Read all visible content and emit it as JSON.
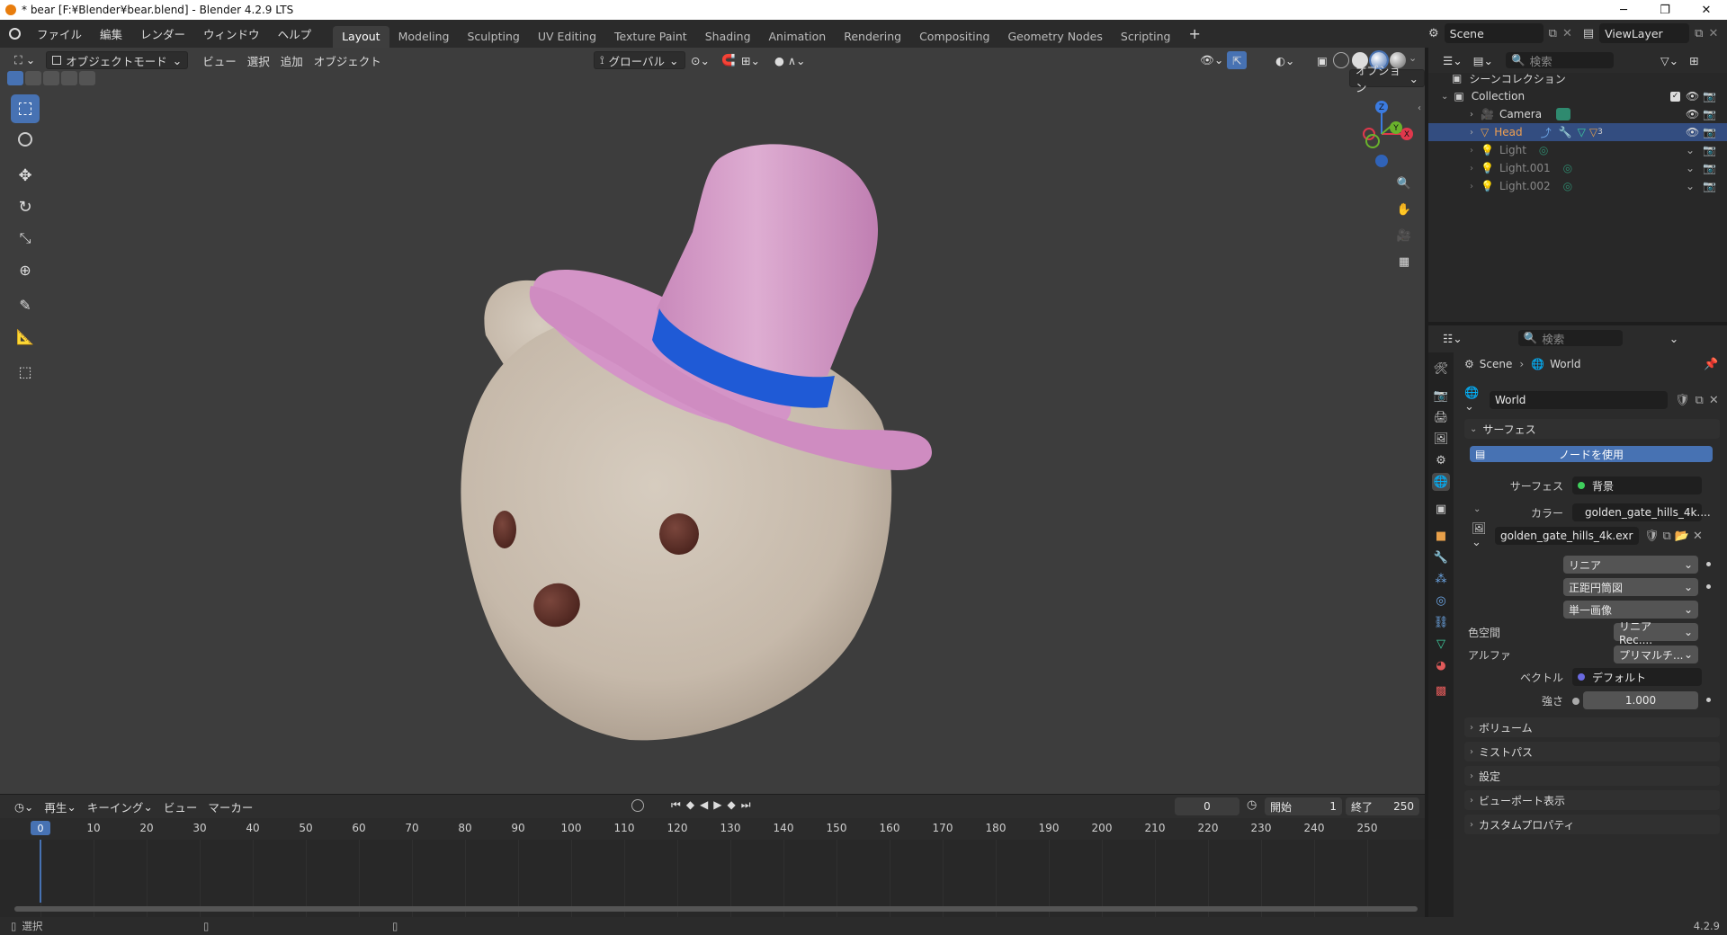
{
  "app": {
    "window_title": "* bear [F:¥Blender¥bear.blend] - Blender 4.2.9 LTS",
    "version": "4.2.9"
  },
  "menu": [
    "ファイル",
    "編集",
    "レンダー",
    "ウィンドウ",
    "ヘルプ"
  ],
  "workspaces": [
    "Layout",
    "Modeling",
    "Sculpting",
    "UV Editing",
    "Texture Paint",
    "Shading",
    "Animation",
    "Rendering",
    "Compositing",
    "Geometry Nodes",
    "Scripting"
  ],
  "active_workspace": "Layout",
  "scene_selector": {
    "scene": "Scene",
    "view_layer": "ViewLayer"
  },
  "viewport": {
    "mode": "オブジェクトモード",
    "menus": [
      "ビュー",
      "選択",
      "追加",
      "オブジェクト"
    ],
    "transform_orientation": "グローバル",
    "options_label": "オプション",
    "gizmo_axes": {
      "x": "X",
      "y": "Y",
      "z": "Z"
    }
  },
  "outliner": {
    "search_placeholder": "検索",
    "root": "シーンコレクション",
    "collection": "Collection",
    "items": [
      {
        "name": "Camera",
        "selected": false
      },
      {
        "name": "Head",
        "selected": true,
        "extra": "3"
      },
      {
        "name": "Light",
        "selected": false
      },
      {
        "name": "Light.001",
        "selected": false
      },
      {
        "name": "Light.002",
        "selected": false
      }
    ]
  },
  "properties": {
    "search_placeholder": "検索",
    "breadcrumb": [
      "Scene",
      "World"
    ],
    "world_name": "World",
    "surface_panel": "サーフェス",
    "use_nodes_button": "ノードを使用",
    "surface_label": "サーフェス",
    "surface_value": "背景",
    "color_label": "カラー",
    "color_value": "golden_gate_hills_4k....",
    "image_name": "golden_gate_hills_4k.exr",
    "interpolation": "リニア",
    "projection": "正距円筒図",
    "source": "単一画像",
    "colorspace_label": "色空間",
    "colorspace_value": "リニア Rec....",
    "alpha_label": "アルファ",
    "alpha_value": "プリマルチ...",
    "vector_label": "ベクトル",
    "vector_value": "デフォルト",
    "strength_label": "強さ",
    "strength_value": "1.000",
    "collapsed_panels": [
      "ボリューム",
      "ミストパス",
      "設定",
      "ビューポート表示",
      "カスタムプロパティ"
    ]
  },
  "timeline": {
    "menus": [
      "再生",
      "キーイング",
      "ビュー",
      "マーカー"
    ],
    "current_frame": "0",
    "start_label": "開始",
    "start_value": "1",
    "end_label": "終了",
    "end_value": "250",
    "ticks": [
      "0",
      "10",
      "20",
      "30",
      "40",
      "50",
      "60",
      "70",
      "80",
      "90",
      "100",
      "110",
      "120",
      "130",
      "140",
      "150",
      "160",
      "170",
      "180",
      "190",
      "200",
      "210",
      "220",
      "230",
      "240",
      "250"
    ]
  },
  "statusbar": {
    "left": "選択",
    "version": "4.2.9"
  },
  "colors": {
    "accent": "#4772b3",
    "selected_row": "#334d80",
    "hat": "#d49ac7",
    "hat_band": "#1f5ad6",
    "bear": "#cbbfb1"
  }
}
